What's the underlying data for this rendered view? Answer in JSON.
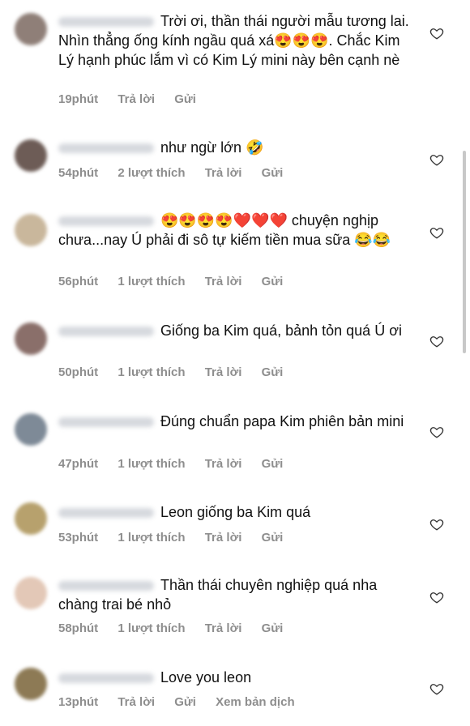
{
  "comments": [
    {
      "text": "Trời ơi, thần thái người mẫu tương lai. Nhìn thẳng ống kính ngầu quá xá😍😍😍. Chắc Kim Lý hạnh phúc lắm vì có Kim Lý mini này bên cạnh nè",
      "time": "19phút",
      "likes": "",
      "reply": "Trả lời",
      "send": "Gửi",
      "extra": "",
      "avatar_color": "#8f7f78"
    },
    {
      "text": "như ngừ lớn 🤣",
      "time": "54phút",
      "likes": "2 lượt thích",
      "reply": "Trả lời",
      "send": "Gửi",
      "extra": "",
      "avatar_color": "#6d5c56"
    },
    {
      "text": "😍😍😍😍❤️❤️❤️ chuyện nghịp chưa...nay Ú phải đi sô tự kiếm tiền mua sữa 😂😂",
      "time": "56phút",
      "likes": "1 lượt thích",
      "reply": "Trả lời",
      "send": "Gửi",
      "extra": "",
      "avatar_color": "#c9b79c"
    },
    {
      "text": "Giống ba Kim quá, bảnh tỏn quá Ú ơi",
      "time": "50phút",
      "likes": "1 lượt thích",
      "reply": "Trả lời",
      "send": "Gửi",
      "extra": "",
      "avatar_color": "#8a6f6a"
    },
    {
      "text": "Đúng chuẩn papa Kim phiên bản mini",
      "time": "47phút",
      "likes": "1 lượt thích",
      "reply": "Trả lời",
      "send": "Gửi",
      "extra": "",
      "avatar_color": "#7e8a97"
    },
    {
      "text": "Leon giống ba Kim quá",
      "time": "53phút",
      "likes": "1 lượt thích",
      "reply": "Trả lời",
      "send": "Gửi",
      "extra": "",
      "avatar_color": "#b7a16d"
    },
    {
      "text": "Thần thái chuyên nghiệp quá nha chàng trai bé nhỏ",
      "time": "58phút",
      "likes": "1 lượt thích",
      "reply": "Trả lời",
      "send": "Gửi",
      "extra": "",
      "avatar_color": "#e3c8b7"
    },
    {
      "text": "Love you leon",
      "time": "13phút",
      "likes": "",
      "reply": "Trả lời",
      "send": "Gửi",
      "extra": "Xem bản dịch",
      "avatar_color": "#8d7a55"
    }
  ]
}
